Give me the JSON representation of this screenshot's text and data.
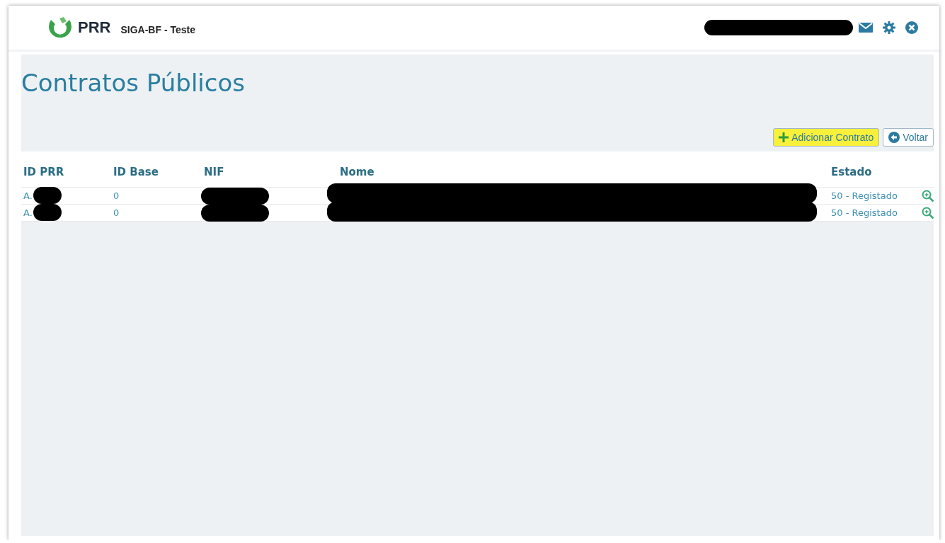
{
  "header": {
    "logo_text": "PRR",
    "app_title": "SIGA-BF - Teste"
  },
  "page": {
    "title": "Contratos Públicos"
  },
  "actions": [
    {
      "kind": "add",
      "label": "Adicionar Contrato",
      "highlighted": true
    },
    {
      "kind": "back",
      "label": "Voltar",
      "highlighted": false
    }
  ],
  "table": {
    "columns": [
      "ID PRR",
      "ID Base",
      "NIF",
      "Nome",
      "Estado"
    ],
    "rows": [
      {
        "id_prr": "A.",
        "id_base": "0",
        "estado": "50 - Registado"
      },
      {
        "id_prr": "A.",
        "id_base": "0",
        "estado": "50 - Registado"
      }
    ]
  }
}
